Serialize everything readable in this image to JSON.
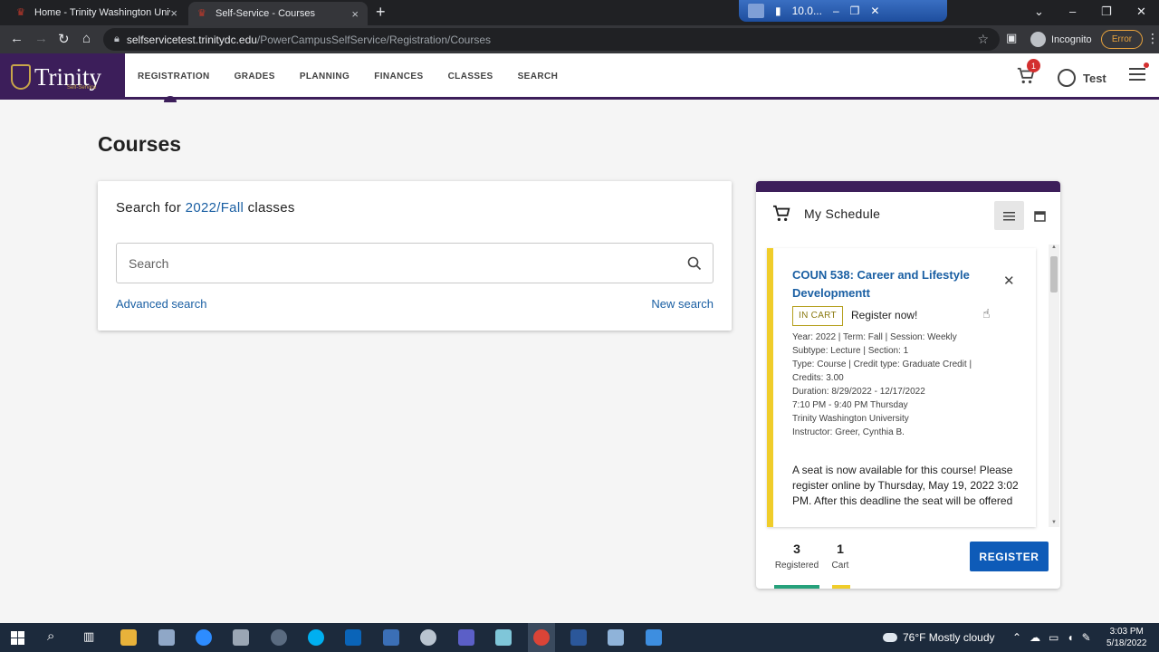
{
  "browser": {
    "tabs": [
      {
        "title": "Home - Trinity Washington Unive",
        "close": "×"
      },
      {
        "title": "Self-Service - Courses",
        "close": "×"
      }
    ],
    "new_tab": "+",
    "remote_title": "10.0...",
    "url_host": "selfservicetest.trinitydc.edu",
    "url_path": "/PowerCampusSelfService/Registration/Courses",
    "incognito": "Incognito",
    "error": "Error"
  },
  "header": {
    "logo_name": "Trinity",
    "logo_sub": "Self-Service",
    "nav": [
      "REGISTRATION",
      "GRADES",
      "PLANNING",
      "FINANCES",
      "CLASSES",
      "SEARCH"
    ],
    "cart_count": "1",
    "user": "Test"
  },
  "page": {
    "title": "Courses"
  },
  "search": {
    "prefix": "Search for",
    "term": "2022/Fall",
    "suffix": "classes",
    "placeholder": "Search",
    "advanced": "Advanced search",
    "new_search": "New search"
  },
  "schedule": {
    "title": "My Schedule",
    "course": {
      "title": "COUN 538: Career and Lifestyle Developmentt",
      "badge": "IN CART",
      "register_now": "Register now!",
      "details": [
        "Year: 2022 | Term: Fall | Session: Weekly",
        "Subtype: Lecture | Section: 1",
        "Type: Course | Credit type: Graduate Credit |",
        "Credits: 3.00",
        "Duration: 8/29/2022 - 12/17/2022",
        "7:10 PM - 9:40 PM Thursday",
        "Trinity Washington University",
        "Instructor: Greer, Cynthia B."
      ],
      "message": "A seat is now available for this course! Please register online by Thursday, May 19, 2022 3:02 PM. After this deadline the seat will be offered"
    },
    "registered_count": "3",
    "registered_label": "Registered",
    "cart_count": "1",
    "cart_label": "Cart",
    "register_button": "REGISTER"
  },
  "taskbar": {
    "weather": "76°F  Mostly cloudy",
    "time": "3:03 PM",
    "date": "5/18/2022"
  },
  "colors": {
    "brand_purple": "#3c1e5a",
    "link_blue": "#1a5fa3",
    "cart_yellow": "#f0cd2a",
    "registered_green": "#26a17b",
    "button_blue": "#0e5bb8"
  }
}
